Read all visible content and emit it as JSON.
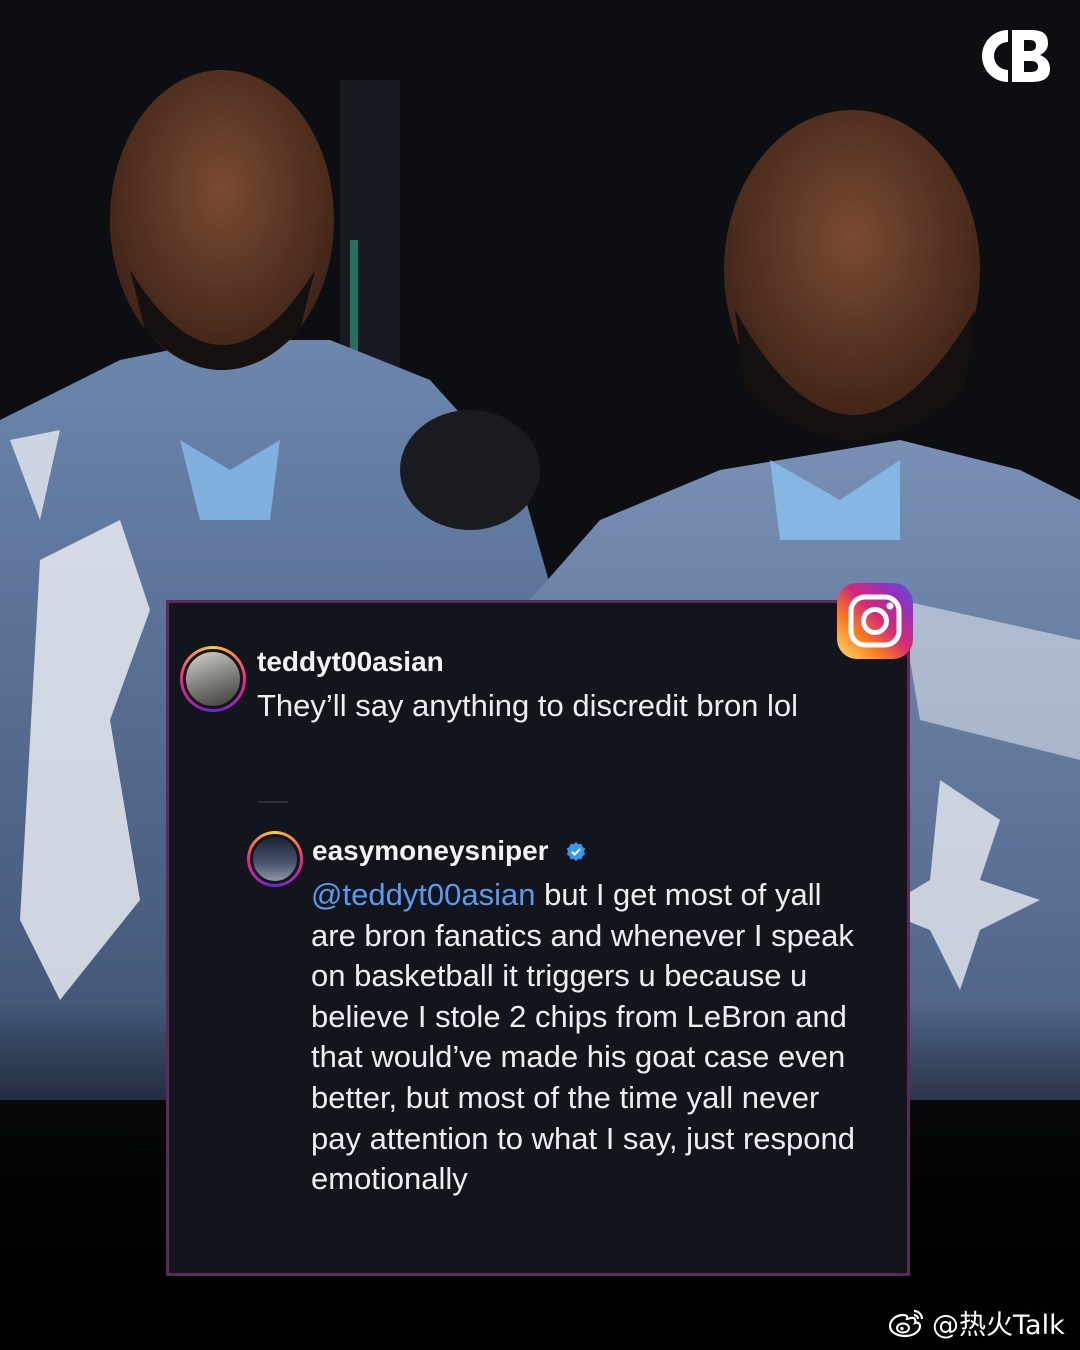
{
  "post": {
    "brand_logo": "CB-logo",
    "platform_icon": "instagram-icon"
  },
  "comments": [
    {
      "username": "teddyt00asian",
      "text": "They’ll say anything to discredit bron lol"
    },
    {
      "username": "easymoneysniper",
      "verified": true,
      "mention": "@teddyt00asian",
      "text": " but I get most of yall are bron fanatics and whenever I speak on basketball it triggers u because u believe I stole 2 chips from LeBron and that would’ve made his goat case even better, but most of the time yall never pay attention to what I say, just respond emotionally"
    }
  ],
  "watermark": {
    "icon": "weibo-icon",
    "text": "@热火Talk"
  },
  "colors": {
    "card_background": "#12151c",
    "card_border": "#5b2a56",
    "mention": "#5b9af0",
    "verified_badge": "#3897f0"
  }
}
